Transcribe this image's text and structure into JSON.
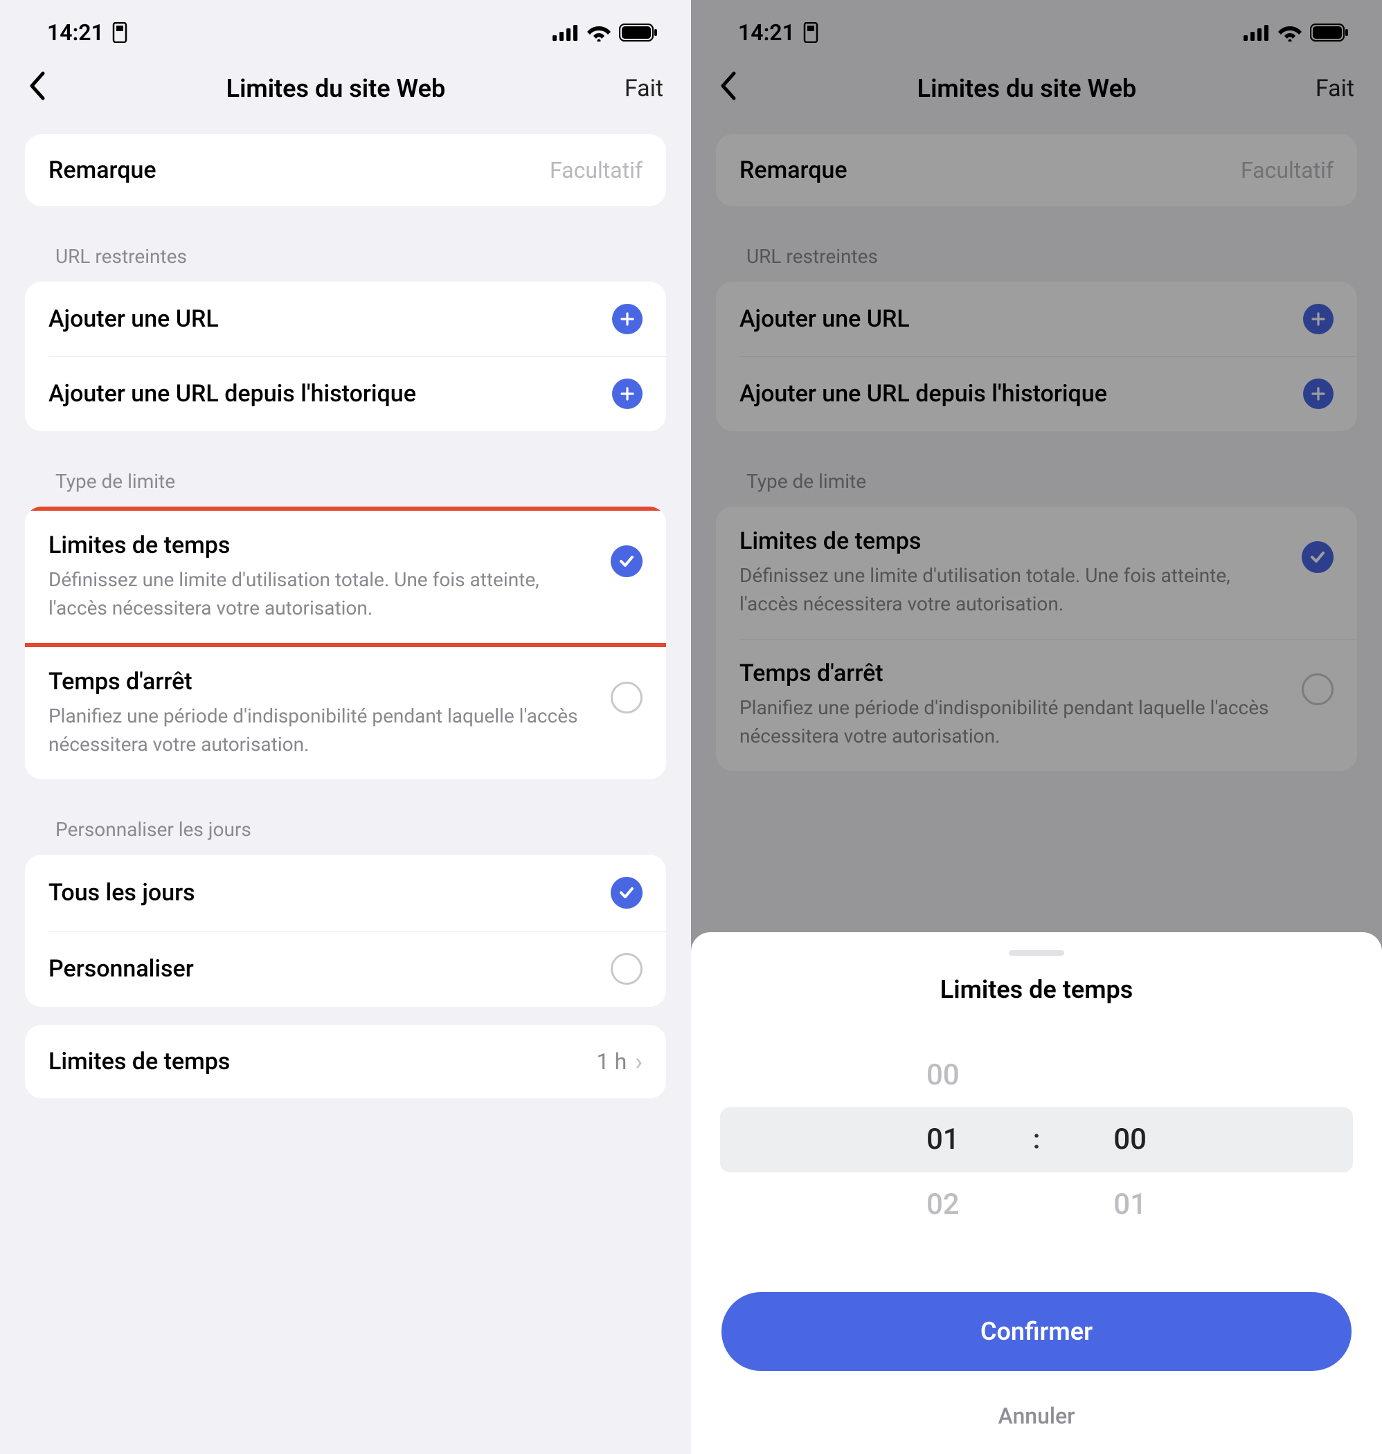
{
  "status": {
    "time": "14:21"
  },
  "nav": {
    "title": "Limites du site Web",
    "done": "Fait"
  },
  "remark": {
    "label": "Remarque",
    "placeholder": "Facultatif"
  },
  "urls": {
    "header": "URL restreintes",
    "add": "Ajouter une URL",
    "add_history": "Ajouter une URL depuis l'historique"
  },
  "limit_type": {
    "header": "Type de limite",
    "time": {
      "title": "Limites de temps",
      "desc": "Définissez une limite d'utilisation totale. Une fois atteinte, l'accès nécessitera votre autorisation."
    },
    "down": {
      "title": "Temps d'arrêt",
      "desc": "Planifiez une période d'indisponibilité pendant laquelle l'accès nécessitera votre autorisation."
    }
  },
  "days": {
    "header": "Personnaliser les jours",
    "every": "Tous les jours",
    "custom": "Personnaliser"
  },
  "time_limit_row": {
    "label": "Limites de temps",
    "value": "1 h"
  },
  "sheet": {
    "title": "Limites de temps",
    "h_prev": "00",
    "h_sel": "01",
    "h_next": "02",
    "m_prev": "",
    "m_sel": "00",
    "m_next": "01",
    "confirm": "Confirmer",
    "cancel": "Annuler"
  }
}
